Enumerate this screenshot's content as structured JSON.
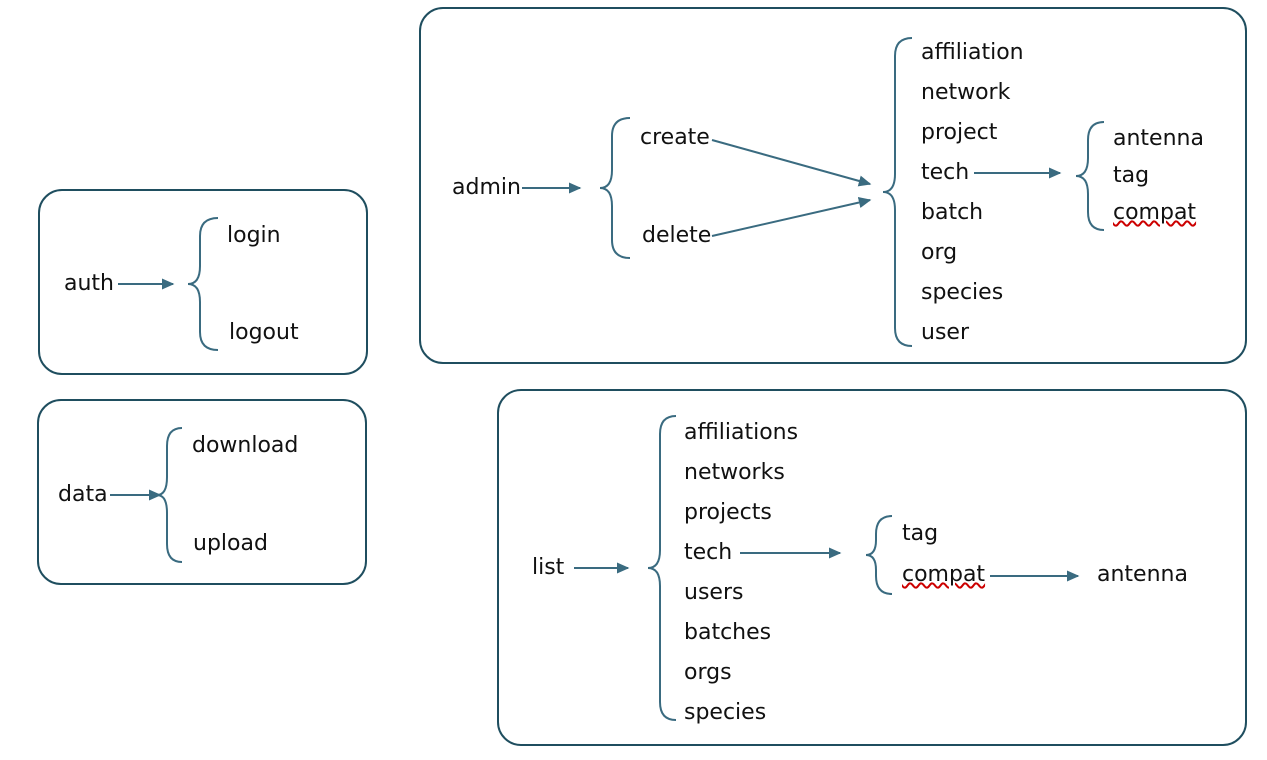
{
  "auth": {
    "root": "auth",
    "items": {
      "login": "login",
      "logout": "logout"
    }
  },
  "data": {
    "root": "data",
    "items": {
      "download": "download",
      "upload": "upload"
    }
  },
  "admin": {
    "root": "admin",
    "actions": {
      "create": "create",
      "delete": "delete"
    },
    "targets": {
      "affiliation": "affiliation",
      "network": "network",
      "project": "project",
      "tech": "tech",
      "batch": "batch",
      "org": "org",
      "species": "species",
      "user": "user"
    },
    "tech_sub": {
      "antenna": "antenna",
      "tag": "tag",
      "compat": "compat"
    }
  },
  "list": {
    "root": "list",
    "items": {
      "affiliations": "affiliations",
      "networks": "networks",
      "projects": "projects",
      "tech": "tech",
      "users": "users",
      "batches": "batches",
      "orgs": "orgs",
      "species": "species"
    },
    "tech_sub": {
      "tag": "tag",
      "compat": "compat"
    },
    "compat_sub": {
      "antenna": "antenna"
    }
  },
  "colors": {
    "border": "#1f4e5f",
    "stroke": "#3a6b80"
  },
  "chart_data": {
    "type": "tree",
    "description": "Four rounded panels each showing a command root expanding via brace brackets into subcommands",
    "panels": [
      {
        "root": "auth",
        "children": [
          "login",
          "logout"
        ]
      },
      {
        "root": "data",
        "children": [
          "download",
          "upload"
        ]
      },
      {
        "root": "admin",
        "children": [
          "create",
          "delete"
        ],
        "shared_targets": [
          "affiliation",
          "network",
          "project",
          "tech",
          "batch",
          "org",
          "species",
          "user"
        ],
        "tech_children": [
          "antenna",
          "tag",
          "compat"
        ]
      },
      {
        "root": "list",
        "children": [
          "affiliations",
          "networks",
          "projects",
          "tech",
          "users",
          "batches",
          "orgs",
          "species"
        ],
        "tech_children": [
          "tag",
          "compat"
        ],
        "compat_children": [
          "antenna"
        ]
      }
    ]
  }
}
